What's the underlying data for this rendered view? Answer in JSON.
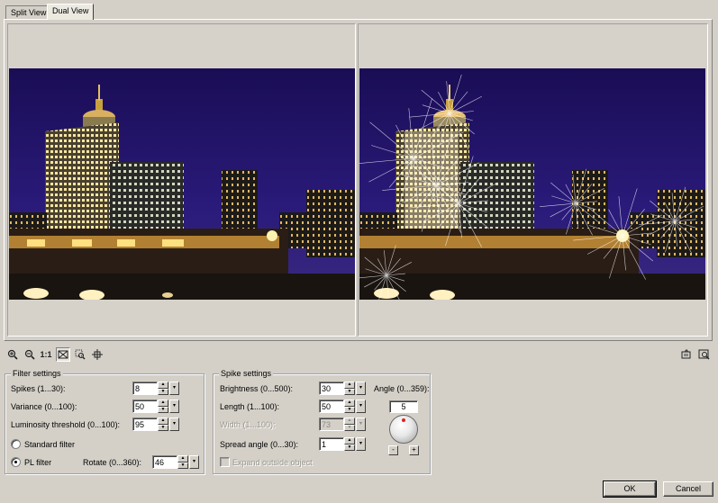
{
  "tabs": [
    {
      "label": "Split View",
      "active": false
    },
    {
      "label": "Dual View",
      "active": true
    }
  ],
  "toolbar": {
    "icons": [
      "zoom-in-icon",
      "zoom-out-icon",
      "actual-size-icon",
      "fit-to-window-icon",
      "zoom-to-area-icon",
      "pan-icon"
    ],
    "actual_size_label": "1:1",
    "right_icons": [
      "preview-icon",
      "autopreview-icon"
    ]
  },
  "filter_settings": {
    "title": "Filter settings",
    "spikes_label": "Spikes (1...30):",
    "spikes_value": "8",
    "variance_label": "Variance (0...100):",
    "variance_value": "50",
    "luminosity_label": "Luminosity threshold (0...100):",
    "luminosity_value": "95",
    "standard_filter_label": "Standard filter",
    "pl_filter_label": "PL filter",
    "selected_filter": "PL filter",
    "rotate_label": "Rotate (0...360):",
    "rotate_value": "46"
  },
  "spike_settings": {
    "title": "Spike settings",
    "brightness_label": "Brightness (0...500):",
    "brightness_value": "30",
    "length_label": "Length (1...100):",
    "length_value": "50",
    "width_label": "Width (1...100):",
    "width_value": "73",
    "width_enabled": false,
    "spread_label": "Spread angle (0...30):",
    "spread_value": "1",
    "expand_label": "Expand outside object",
    "expand_checked": false,
    "expand_enabled": false,
    "angle_label": "Angle (0...359):",
    "angle_value": "5",
    "minus_label": "-",
    "plus_label": "+"
  },
  "buttons": {
    "ok": "OK",
    "cancel": "Cancel"
  },
  "colors": {
    "dialog_bg": "#d4d0c8",
    "sky": "#1b0f5a",
    "light": "#ffe79a"
  }
}
